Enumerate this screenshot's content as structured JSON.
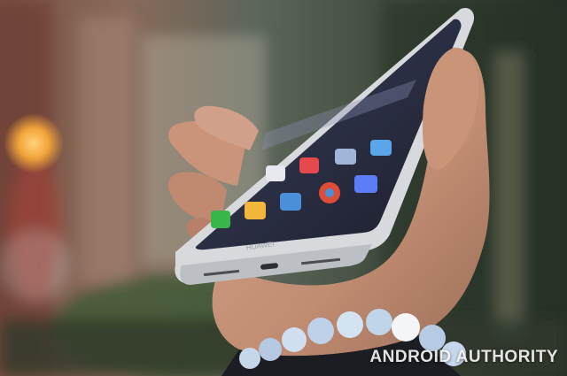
{
  "photo": {
    "subject": "hand holding smartphone",
    "phone_brand": "HUAWEI",
    "watermark": "ANDROID AUTHORITY"
  },
  "colors": {
    "phone_frame": "#d8dadd",
    "screen": "#2b2f44",
    "background_left": "#7d5a48",
    "background_right": "#2f3a2e",
    "light_bokeh": "#f2a43a",
    "skin": "#c99a80",
    "bracelet": "#cfe0f2"
  },
  "apps": [
    {
      "icon": "camera-icon",
      "color": "#e6e8ee"
    },
    {
      "icon": "video-icon",
      "color": "#e5484d"
    },
    {
      "icon": "gallery-icon",
      "color": "#9fb6d8"
    },
    {
      "icon": "weather-icon",
      "color": "#5aa6e8"
    },
    {
      "icon": "phone-icon",
      "color": "#39b54a"
    },
    {
      "icon": "mail-icon",
      "color": "#f2b63a"
    },
    {
      "icon": "messages-icon",
      "color": "#4a90d9"
    },
    {
      "icon": "chrome-icon",
      "color": "#dd4b39"
    },
    {
      "icon": "browser-icon",
      "color": "#5c7cfa"
    }
  ]
}
